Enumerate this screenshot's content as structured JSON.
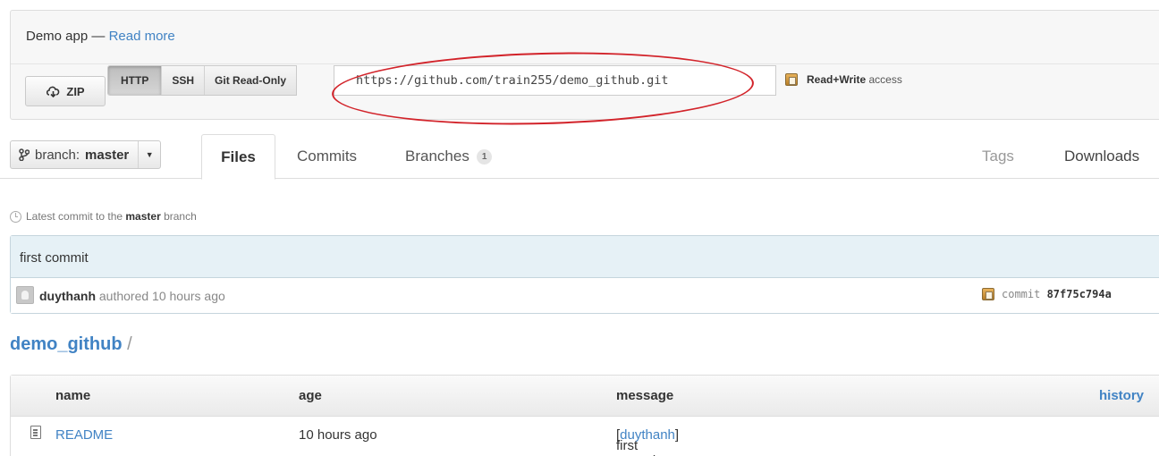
{
  "repo": {
    "description": "Demo app",
    "separator": " — ",
    "read_more": "Read more"
  },
  "clone": {
    "zip_label": "ZIP",
    "protocols": [
      "HTTP",
      "SSH",
      "Git Read-Only"
    ],
    "selected_protocol": "HTTP",
    "url": "https://github.com/train255/demo_github.git",
    "access_bold": "Read+Write",
    "access_suffix": " access"
  },
  "nav": {
    "branch_prefix": "branch: ",
    "branch_name": "master",
    "tabs": {
      "files": "Files",
      "commits": "Commits",
      "branches": "Branches",
      "branches_count": "1",
      "tags": "Tags",
      "downloads": "Downloads"
    }
  },
  "latest_commit": {
    "note_prefix": "Latest commit to the ",
    "note_branch": "master",
    "note_suffix": " branch",
    "message": "first commit",
    "author": "duythanh",
    "authored_text": " authored 10 hours ago",
    "sha_label": "commit ",
    "sha": "87f75c794a"
  },
  "path": {
    "repo_name": "demo_github",
    "separator": " /"
  },
  "file_table": {
    "columns": [
      "name",
      "age",
      "message",
      "history"
    ],
    "rows": [
      {
        "name": "README",
        "age": "10 hours ago",
        "message": "first commit",
        "message_author": "duythanh"
      }
    ]
  },
  "colors": {
    "link": "#4183c4",
    "annotation_oval": "#d2232a",
    "commit_header_bg": "#e6f1f6"
  },
  "icons": [
    "zip-download-icon",
    "clipboard-icon",
    "branch-icon",
    "caret-down-icon",
    "clock-icon",
    "avatar",
    "file-icon"
  ]
}
